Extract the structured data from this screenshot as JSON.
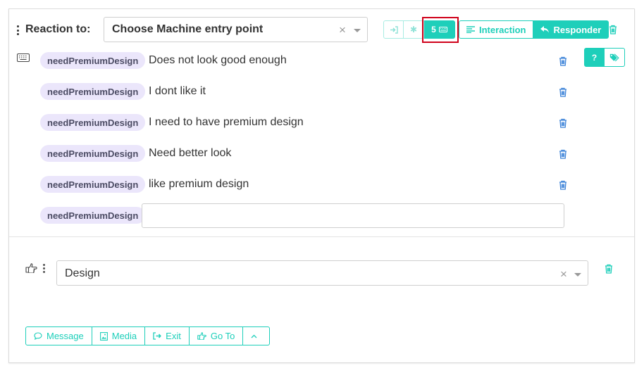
{
  "header": {
    "reaction_label": "Reaction to:",
    "entry_select": {
      "value": "Choose Machine entry point",
      "clear": "×"
    },
    "mode_buttons": [
      {
        "icon": "sign-in-icon"
      },
      {
        "icon": "asterisk-icon",
        "glyph": "✱"
      },
      {
        "label": "5",
        "icon": "keyboard-icon",
        "active": true
      }
    ],
    "role_buttons": [
      {
        "label": "Interaction",
        "icon": "align-left-icon",
        "active": false
      },
      {
        "label": "Responder",
        "icon": "reply-icon",
        "active": true
      }
    ],
    "side_buttons": [
      {
        "label": "?",
        "active": true
      },
      {
        "icon": "tags-icon",
        "active": false
      }
    ]
  },
  "rows": [
    {
      "tag": "needPremiumDesign",
      "text": "Does not look good enough"
    },
    {
      "tag": "needPremiumDesign",
      "text": "I dont like it"
    },
    {
      "tag": "needPremiumDesign",
      "text": "I need to have premium design"
    },
    {
      "tag": "needPremiumDesign",
      "text": "Need better look"
    },
    {
      "tag": "needPremiumDesign",
      "text": "like premium design"
    }
  ],
  "new_row": {
    "tag": "needPremiumDesign",
    "value": ""
  },
  "response": {
    "select": {
      "value": "Design",
      "clear": "×"
    }
  },
  "actions": [
    {
      "label": "Message",
      "icon": "comment-icon"
    },
    {
      "label": "Media",
      "icon": "image-icon"
    },
    {
      "label": "Exit",
      "icon": "sign-out-icon"
    },
    {
      "label": "Go To",
      "icon": "hand-point-icon"
    },
    {
      "label": "",
      "icon": "chevron-up-icon"
    }
  ],
  "colors": {
    "accent": "#1ecfba",
    "tag_bg": "#ebe6fb",
    "trash": "#3b82d8",
    "highlight": "#d0021b"
  }
}
